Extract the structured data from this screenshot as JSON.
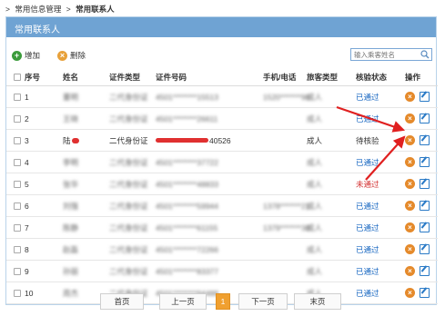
{
  "breadcrumb": {
    "sep1": ">",
    "item1": "常用信息管理",
    "sep2": ">",
    "item2": "常用联系人"
  },
  "panel": {
    "title": "常用联系人"
  },
  "toolbar": {
    "add_label": "增加",
    "delete_label": "删除",
    "search_placeholder": "输入乘客姓名"
  },
  "table": {
    "headers": {
      "no": "序号",
      "name": "姓名",
      "id_type": "证件类型",
      "id_number": "证件号码",
      "phone": "手机/电话",
      "passenger_type": "旅客类型",
      "status": "核验状态",
      "op": "操作"
    },
    "rows": [
      {
        "no": "1",
        "name": "董明",
        "id_type": "二代身份证",
        "id_number": "4501********15513",
        "phone": "1520*******96",
        "ptype": "成人",
        "status": "已通过",
        "status_kind": "pass"
      },
      {
        "no": "2",
        "name": "王晓",
        "id_type": "二代身份证",
        "id_number": "4501********26611",
        "phone": "",
        "ptype": "成人",
        "status": "已通过",
        "status_kind": "pass"
      },
      {
        "no": "3",
        "name": "陆",
        "id_type": "二代身份证",
        "id_number": "40526",
        "phone": "",
        "ptype": "成人",
        "status": "待核验",
        "status_kind": "wait"
      },
      {
        "no": "4",
        "name": "李明",
        "id_type": "二代身份证",
        "id_number": "4501********37722",
        "phone": "",
        "ptype": "成人",
        "status": "已通过",
        "status_kind": "pass"
      },
      {
        "no": "5",
        "name": "张华",
        "id_type": "二代身份证",
        "id_number": "4501********48833",
        "phone": "",
        "ptype": "成人",
        "status": "未通过",
        "status_kind": "fail"
      },
      {
        "no": "6",
        "name": "刘强",
        "id_type": "二代身份证",
        "id_number": "4501********59944",
        "phone": "1378*******21",
        "ptype": "成人",
        "status": "已通过",
        "status_kind": "pass"
      },
      {
        "no": "7",
        "name": "陈静",
        "id_type": "二代身份证",
        "id_number": "4501********61155",
        "phone": "1379*******38",
        "ptype": "成人",
        "status": "已通过",
        "status_kind": "pass"
      },
      {
        "no": "8",
        "name": "赵磊",
        "id_type": "二代身份证",
        "id_number": "4501********72266",
        "phone": "",
        "ptype": "成人",
        "status": "已通过",
        "status_kind": "pass"
      },
      {
        "no": "9",
        "name": "孙丽",
        "id_type": "二代身份证",
        "id_number": "4501********83377",
        "phone": "",
        "ptype": "成人",
        "status": "已通过",
        "status_kind": "pass"
      },
      {
        "no": "10",
        "name": "周杰",
        "id_type": "二代身份证",
        "id_number": "4501********94488",
        "phone": "",
        "ptype": "成人",
        "status": "已通过",
        "status_kind": "pass"
      }
    ]
  },
  "pager": {
    "first": "首页",
    "prev": "上一页",
    "current": "1",
    "next": "下一页",
    "last": "末页"
  },
  "colors": {
    "accent": "#6fa3d3",
    "pass": "#1565c0",
    "fail": "#d32f2f",
    "annotation_arrow": "#e02020",
    "page_active": "#f0a030"
  },
  "icons": {
    "add": "plus-circle-icon",
    "delete": "x-circle-icon",
    "search": "search-icon",
    "row_delete": "x-circle-icon",
    "row_edit": "edit-icon"
  }
}
